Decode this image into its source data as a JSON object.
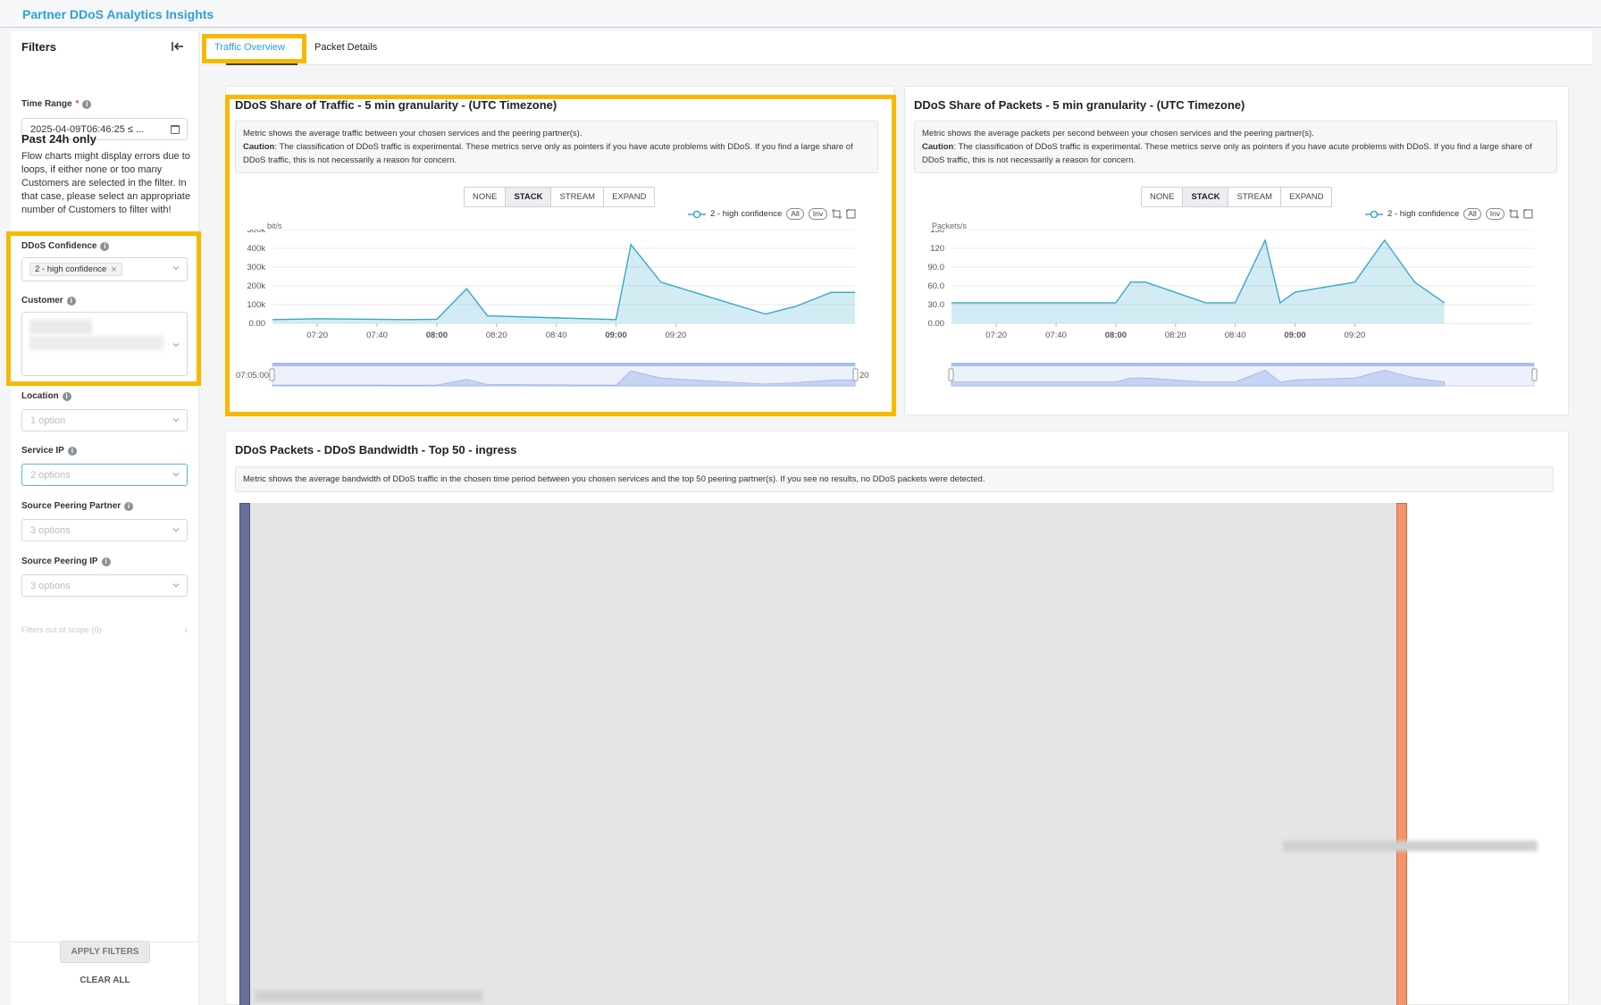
{
  "app": {
    "title": "Partner DDoS Analytics Insights"
  },
  "sidebar": {
    "title": "Filters",
    "time_range": {
      "label": "Time Range",
      "required_mark": "*",
      "value": "2025-04-09T06:46:25 ≤ ..."
    },
    "note": {
      "title": "Past 24h only",
      "body": "Flow charts might display errors due to loops, if either none or too many Customers are selected in the filter. In that case, please select an appropriate number of Customers to filter with!"
    },
    "ddos_confidence": {
      "label": "DDoS Confidence",
      "tag": "2 - high confidence"
    },
    "customer": {
      "label": "Customer"
    },
    "location": {
      "label": "Location",
      "placeholder": "1 option"
    },
    "service_ip": {
      "label": "Service IP",
      "placeholder": "2 options"
    },
    "source_peering_partner": {
      "label": "Source Peering Partner",
      "placeholder": "3 options"
    },
    "source_peering_ip": {
      "label": "Source Peering IP",
      "placeholder": "3 options"
    },
    "out_of_scope": "Filters out of scope (0)",
    "apply": "APPLY FILTERS",
    "clear": "CLEAR ALL"
  },
  "tabs": [
    {
      "label": "Traffic Overview",
      "active": true
    },
    {
      "label": "Packet Details",
      "active": false
    }
  ],
  "chart_controls": {
    "modes": [
      "NONE",
      "STACK",
      "STREAM",
      "EXPAND"
    ],
    "active_mode": "STACK",
    "legend_label": "2 - high confidence",
    "all": "All",
    "inv": "Inv"
  },
  "traffic_card": {
    "title": "DDoS Share of Traffic - 5 min granularity - (UTC Timezone)",
    "desc_line1": "Metric shows the average traffic between your chosen services and the peering partner(s).",
    "caution_label": "Caution",
    "desc_caution": ": The classification of DDoS traffic is experimental. These metrics serve only as pointers if you have acute problems with DDoS. If you find a large share of DDoS traffic, this is not necessarily a reason for concern.",
    "brush_start": "07:05:00",
    "brush_end": "20"
  },
  "packets_card": {
    "title": "DDoS Share of Packets - 5 min granularity - (UTC Timezone)",
    "desc_line1": "Metric shows the average packets per second between your chosen services and the peering partner(s).",
    "caution_label": "Caution",
    "desc_caution": ": The classification of DDoS traffic is experimental. These metrics serve only as pointers if you have acute problems with DDoS. If you find a large share of DDoS traffic, this is not necessarily a reason for concern."
  },
  "sankey_card": {
    "title": "DDoS Packets - DDoS Bandwidth - Top 50 - ingress",
    "desc": "Metric shows the average bandwidth of DDoS traffic in the chosen time period between you chosen services and the top 50 peering partner(s). If you see no results, no DDoS packets were detected."
  },
  "chart_data": [
    {
      "type": "area",
      "title": "DDoS Share of Traffic - 5 min granularity - (UTC Timezone)",
      "ylabel": "bit/s",
      "ylim": [
        0,
        500000
      ],
      "yticks": [
        "500k",
        "400k",
        "300k",
        "200k",
        "100k",
        "0.00"
      ],
      "xticks": [
        "07:20",
        "07:40",
        "08:00",
        "08:20",
        "08:40",
        "09:00",
        "09:20"
      ],
      "xticks_bold": [
        "08:00",
        "09:00"
      ],
      "xrange_minutes": [
        425,
        583
      ],
      "series": [
        {
          "name": "2 - high confidence",
          "color": "#35a9c9",
          "x": [
            425,
            440,
            470,
            480,
            490,
            497,
            540,
            545,
            555,
            590,
            600,
            612,
            620
          ],
          "values": [
            20000,
            25000,
            20000,
            22000,
            185000,
            40000,
            20000,
            420000,
            220000,
            50000,
            90000,
            165000,
            165000
          ]
        }
      ]
    },
    {
      "type": "area",
      "title": "DDoS Share of Packets - 5 min granularity - (UTC Timezone)",
      "ylabel": "Packets/s",
      "ylim": [
        0,
        150
      ],
      "yticks": [
        "150",
        "120",
        "90.0",
        "60.0",
        "30.0",
        "0.00"
      ],
      "xticks": [
        "07:20",
        "07:40",
        "08:00",
        "08:20",
        "08:40",
        "09:00",
        "09:20"
      ],
      "xticks_bold": [
        "08:00",
        "09:00"
      ],
      "series": [
        {
          "name": "2 - high confidence",
          "color": "#35a9c9",
          "x": [
            425,
            480,
            485,
            490,
            510,
            520,
            530,
            535,
            540,
            560,
            570,
            580,
            590
          ],
          "values": [
            33,
            33,
            66,
            66,
            33,
            33,
            133,
            33,
            50,
            66,
            133,
            66,
            33
          ]
        }
      ]
    }
  ]
}
